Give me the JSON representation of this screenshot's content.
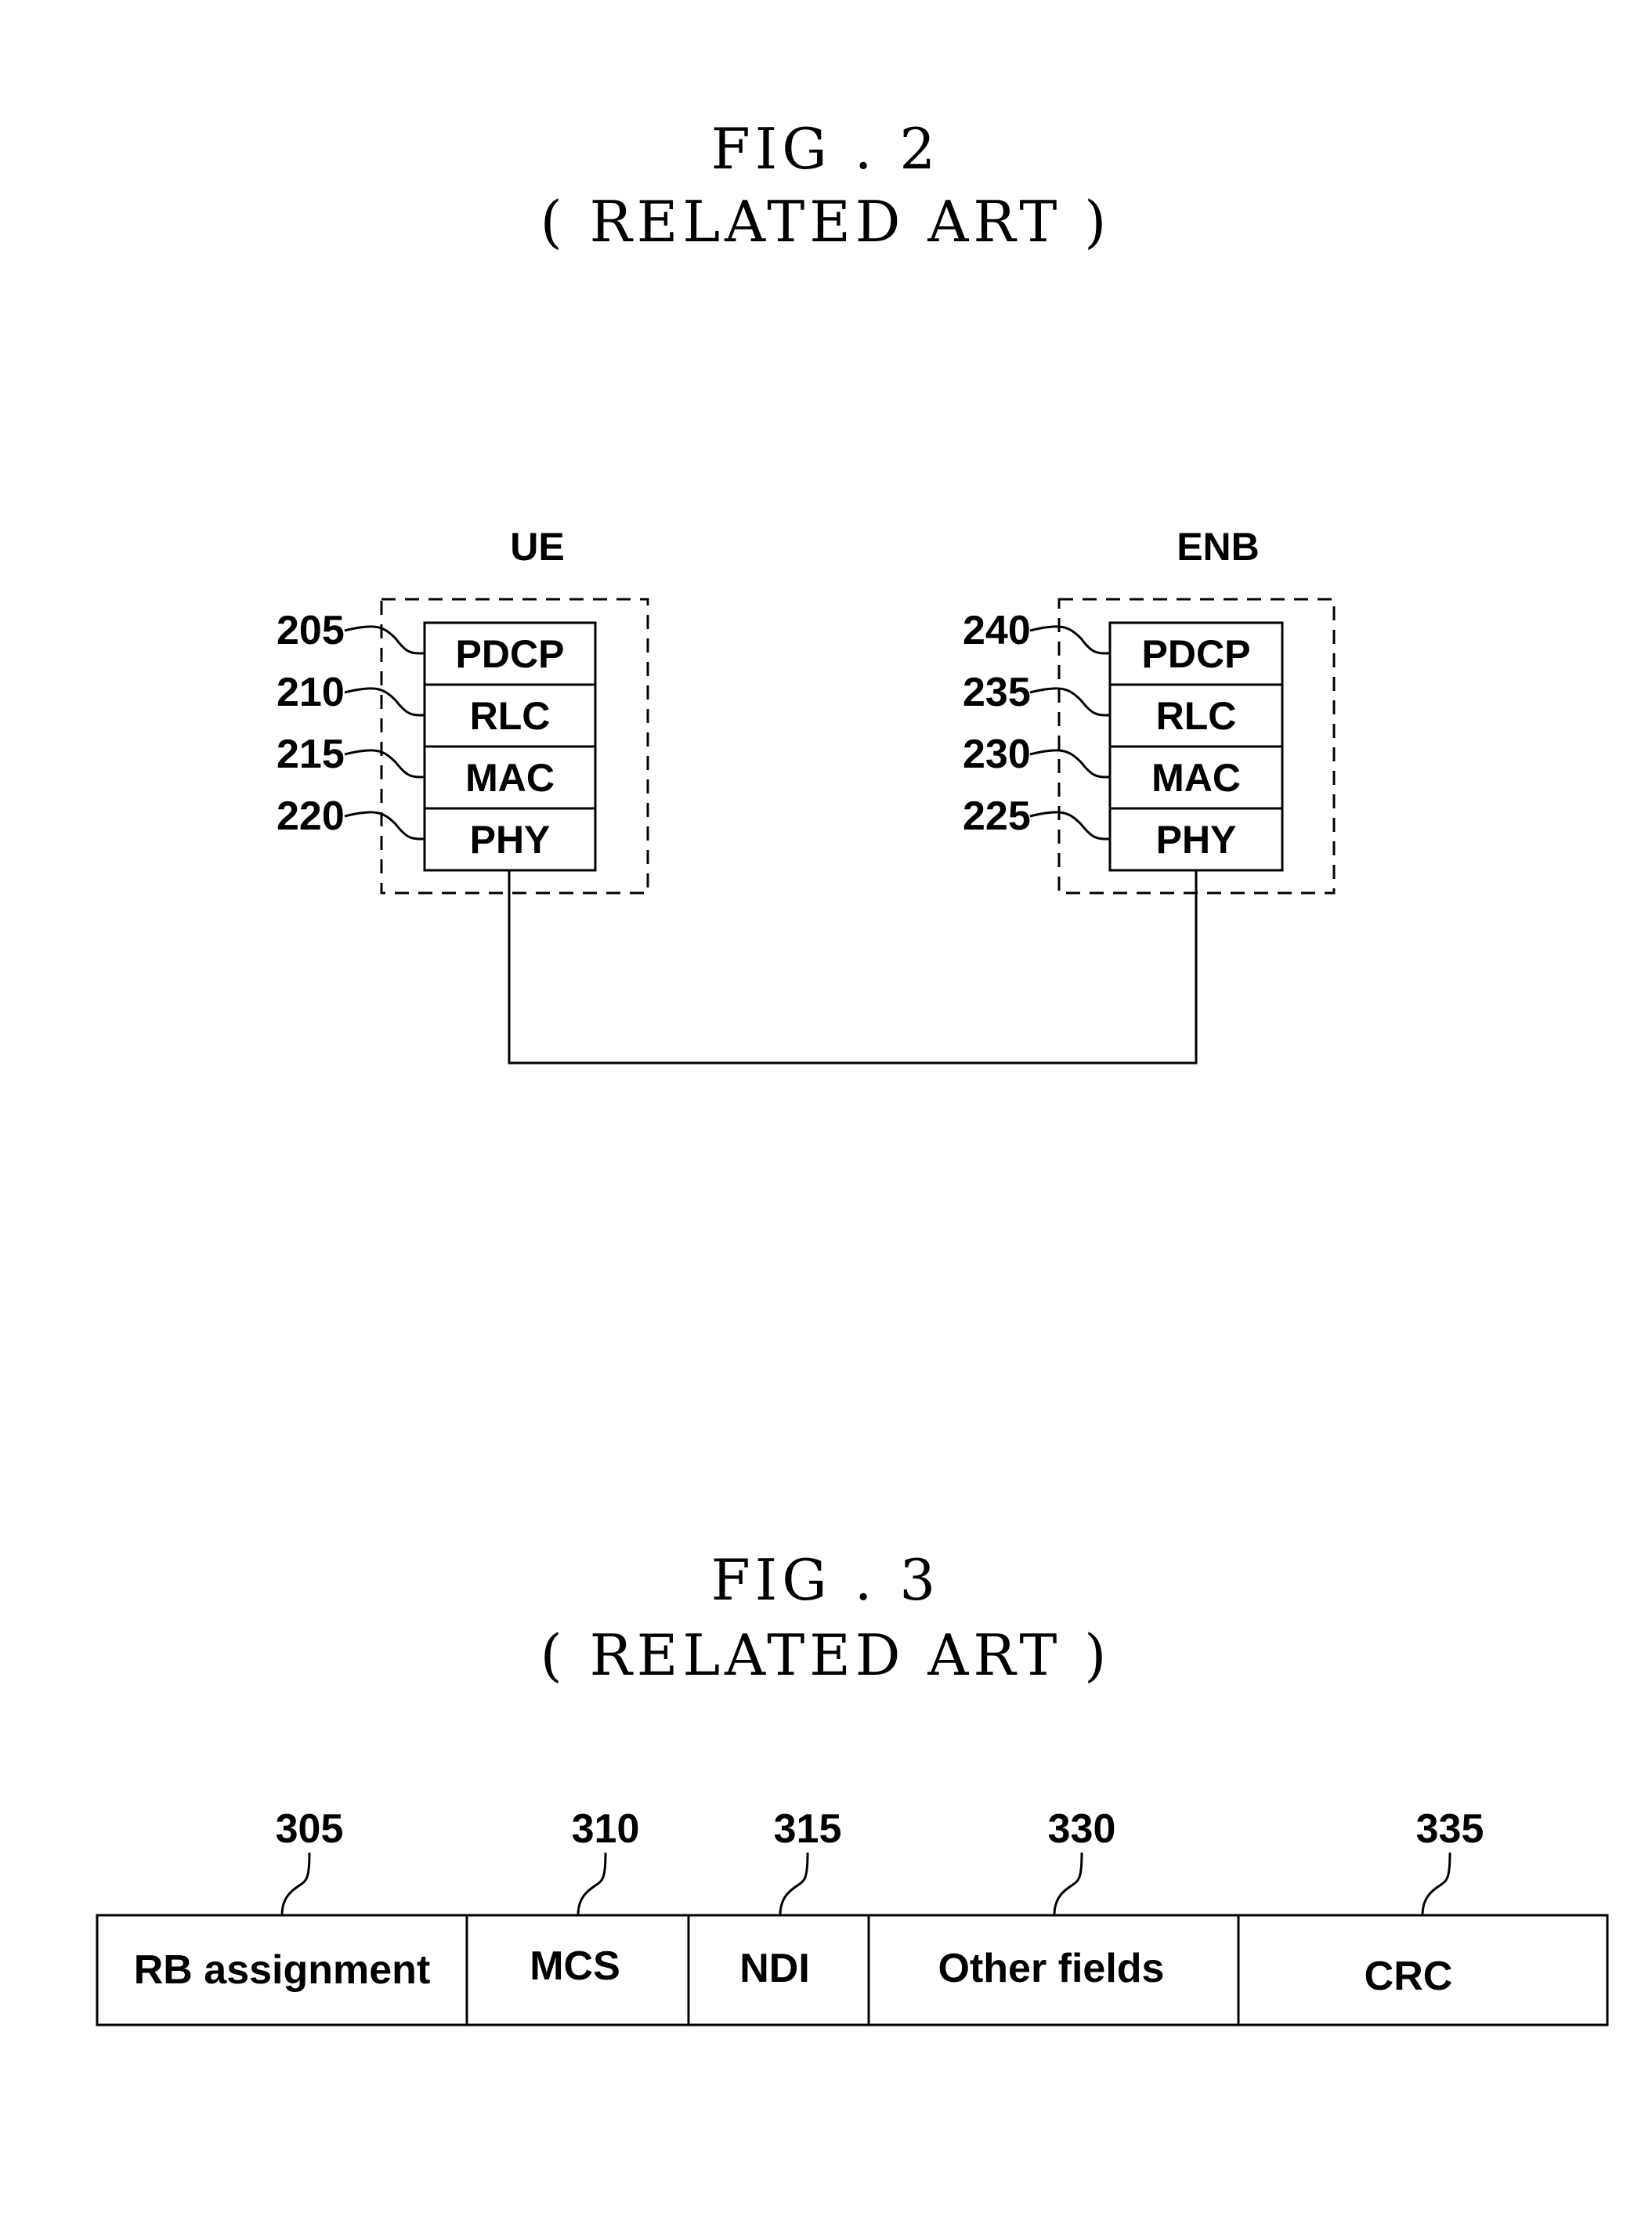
{
  "fig2": {
    "title": "FIG . 2",
    "subtitle": "( RELATED ART )",
    "ue": {
      "label": "UE",
      "layers": [
        {
          "name": "PDCP",
          "ref": "205"
        },
        {
          "name": "RLC",
          "ref": "210"
        },
        {
          "name": "MAC",
          "ref": "215"
        },
        {
          "name": "PHY",
          "ref": "220"
        }
      ]
    },
    "enb": {
      "label": "ENB",
      "layers": [
        {
          "name": "PDCP",
          "ref": "240"
        },
        {
          "name": "RLC",
          "ref": "235"
        },
        {
          "name": "MAC",
          "ref": "230"
        },
        {
          "name": "PHY",
          "ref": "225"
        }
      ]
    }
  },
  "fig3": {
    "title": "FIG . 3",
    "subtitle": "( RELATED ART )",
    "fields": [
      {
        "name": "RB assignment",
        "ref": "305"
      },
      {
        "name": "MCS",
        "ref": "310"
      },
      {
        "name": "NDI",
        "ref": "315"
      },
      {
        "name": "Other fields",
        "ref": "330"
      },
      {
        "name": "CRC",
        "ref": "335"
      }
    ]
  }
}
